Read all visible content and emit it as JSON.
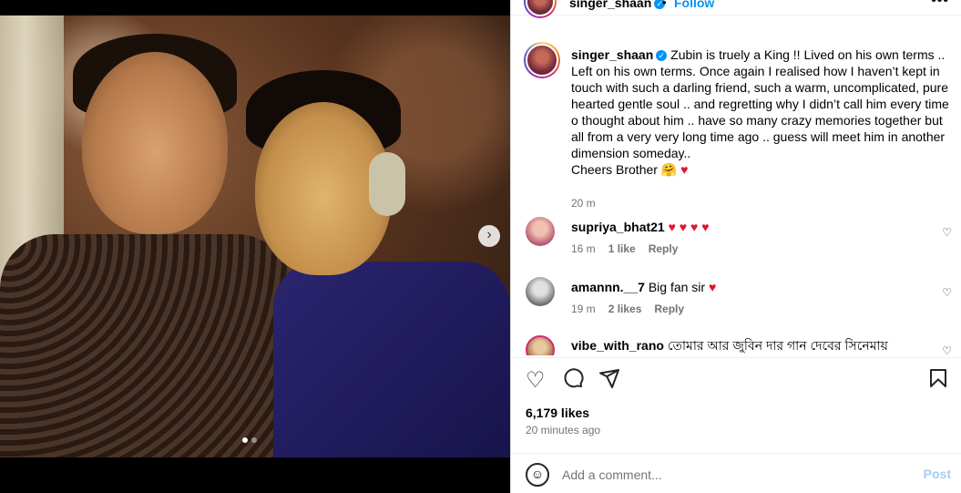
{
  "header": {
    "username": "singer_shaan",
    "dot": "•",
    "follow_label": "Follow",
    "more": "•••"
  },
  "caption": {
    "username": "singer_shaan",
    "text": "Zubin is truely a King !! Lived on his own terms .. Left on his own terms. Once again I realised how I haven’t kept in touch with such a darling friend, such a warm, uncomplicated, pure hearted gentle soul .. and regretting why I didn’t call him every time o thought about him .. have so many crazy memories together but all from a very very long time ago .. guess will meet him in another dimension someday..",
    "line2": "Cheers Brother 🤗",
    "time": "20 m"
  },
  "comments": [
    {
      "username": "supriya_bhat21",
      "text": "",
      "hearts": "♥ ♥ ♥ ♥",
      "time": "16 m",
      "likes": "1 like",
      "reply": "Reply",
      "avatar_color": "#b65a72"
    },
    {
      "username": "amannn.__7",
      "text": "Big fan sir",
      "hearts": "♥",
      "time": "19 m",
      "likes": "2 likes",
      "reply": "Reply",
      "avatar_color": "#707070"
    },
    {
      "username": "vibe_with_rano",
      "text": "তোমার আর জুবিন দার গান দেবের সিনেমায়",
      "hearts": "",
      "time": "",
      "likes": "",
      "reply": "",
      "avatar_color": "#a0704a"
    }
  ],
  "actions": {
    "like_icon": "heart-outline-icon",
    "comment_icon": "comment-bubble-icon",
    "share_icon": "paper-plane-icon",
    "save_icon": "bookmark-icon"
  },
  "likes_count": "6,179 likes",
  "posted_ago": "20 minutes ago",
  "comment_input": {
    "placeholder": "Add a comment...",
    "post_label": "Post"
  },
  "carousel": {
    "next": "›",
    "total_slides": 2,
    "active_slide": 1
  }
}
